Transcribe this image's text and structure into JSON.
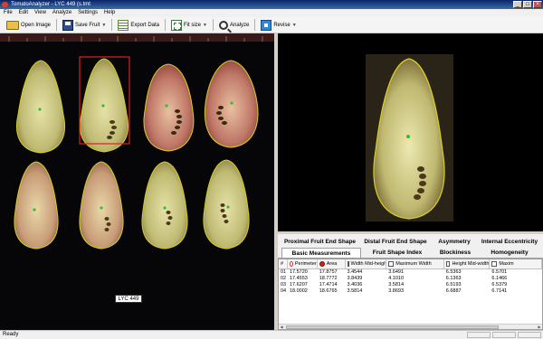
{
  "window": {
    "title": "TomatoAnalyzer - LYC 449 (s.tmt"
  },
  "menu": [
    "File",
    "Edit",
    "View",
    "Analyze",
    "Settings",
    "Help"
  ],
  "toolbar": {
    "open_label": "Open Image",
    "save_label": "Save Fruit",
    "export_label": "Export Data",
    "fit_label": "Fit size",
    "analyze_label": "Analyze",
    "revise_label": "Revise"
  },
  "scan": {
    "label": "LYC 449",
    "selected_fruit": 2
  },
  "tabs": {
    "row1": [
      "Proximal Fruit End Shape",
      "Distal Fruit End Shape",
      "Asymmetry",
      "Internal Eccentricity"
    ],
    "row2": [
      "Basic Measurements",
      "Fruit Shape Index",
      "Blockiness",
      "Homogeneity"
    ],
    "active": "Basic Measurements"
  },
  "table": {
    "headers": [
      "#",
      "Perimeter",
      "Area",
      "Width Mid-height",
      "Maximum Width",
      "Height Mid-width",
      "Maxim"
    ],
    "rows": [
      [
        "01",
        "17.5720",
        "17.8757",
        "3.4544",
        "3.6491",
        "6.5363",
        "6.5701"
      ],
      [
        "02",
        "17.4553",
        "18.7772",
        "3.8439",
        "4.1010",
        "6.1363",
        "6.1466"
      ],
      [
        "03",
        "17.6207",
        "17.4714",
        "3.4036",
        "3.5814",
        "6.5193",
        "6.5379"
      ],
      [
        "04",
        "18.0002",
        "18.6765",
        "3.5814",
        "3.8693",
        "6.6887",
        "6.7141"
      ]
    ]
  },
  "status": {
    "text": "Ready"
  },
  "colors": {
    "titlebar": "#0a246a",
    "outline": "#d8d020",
    "selection": "#e02020",
    "scan_bg": "#000000"
  }
}
